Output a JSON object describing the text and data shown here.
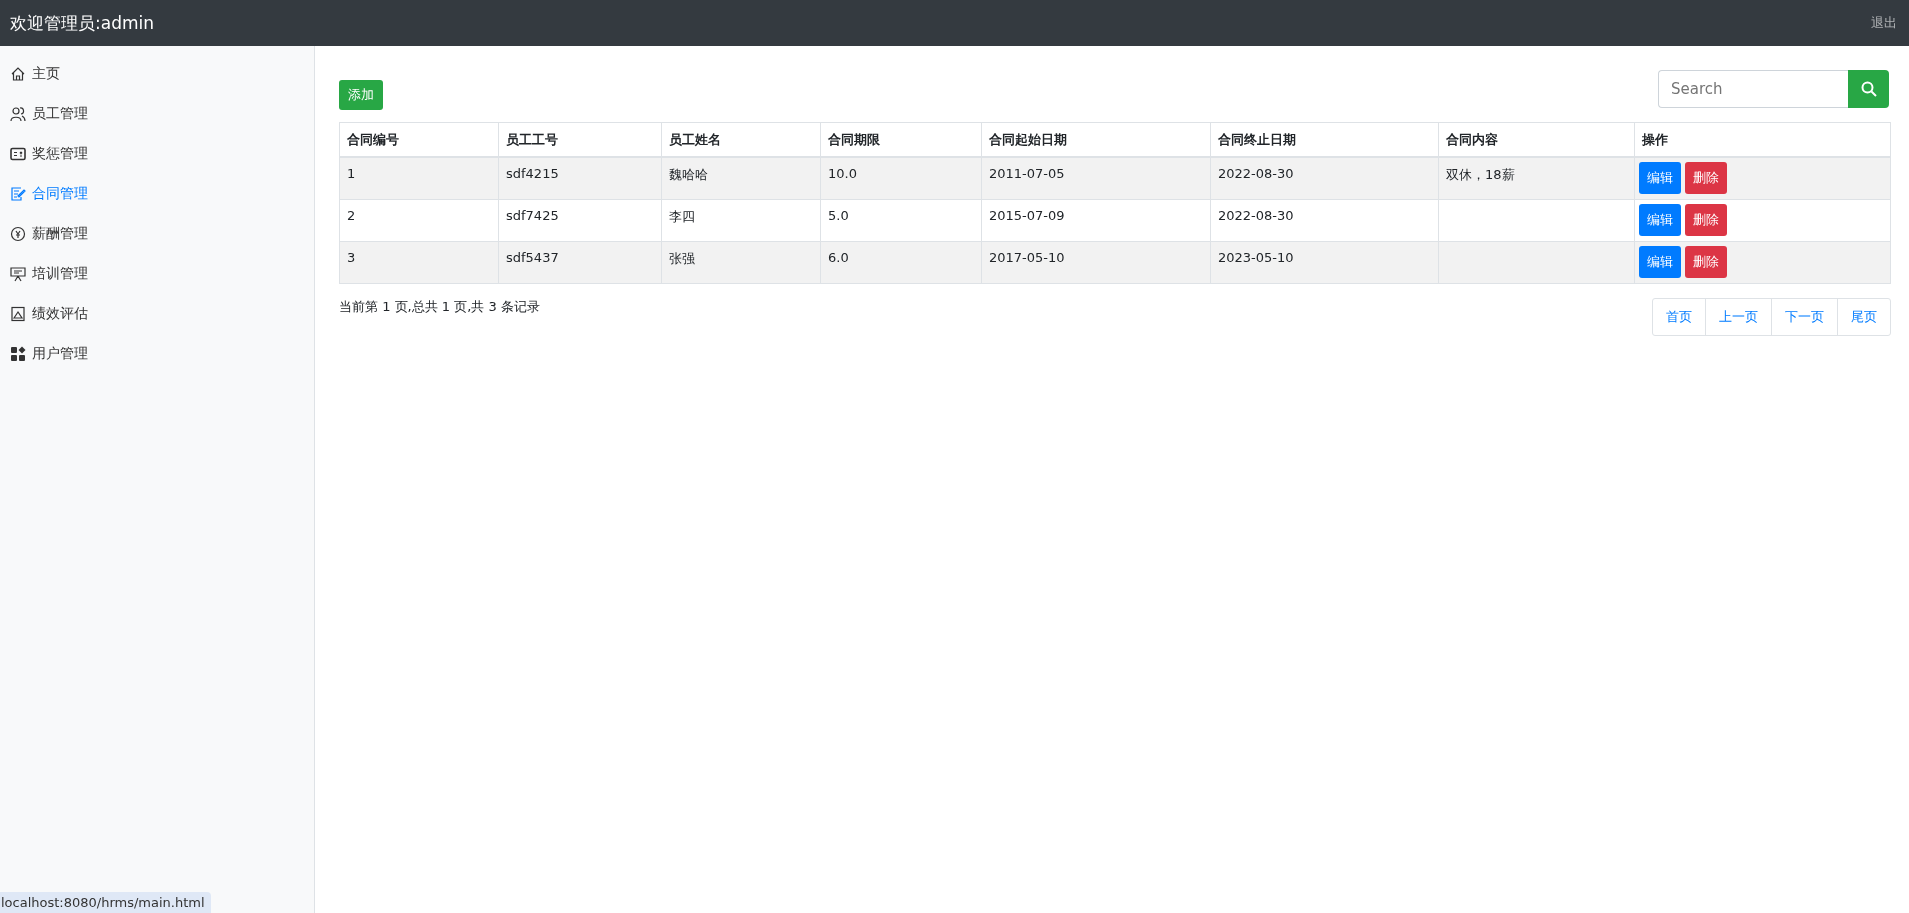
{
  "header": {
    "title": "欢迎管理员:admin",
    "logout": "退出"
  },
  "sidebar": {
    "items": [
      {
        "label": "主页",
        "selected": false
      },
      {
        "label": "员工管理",
        "selected": false
      },
      {
        "label": "奖惩管理",
        "selected": false
      },
      {
        "label": "合同管理",
        "selected": true
      },
      {
        "label": "薪酬管理",
        "selected": false
      },
      {
        "label": "培训管理",
        "selected": false
      },
      {
        "label": "绩效评估",
        "selected": false
      },
      {
        "label": "用户管理",
        "selected": false
      }
    ]
  },
  "toolbar": {
    "add_button": "添加",
    "search": {
      "placeholder": "Search"
    }
  },
  "table": {
    "columns": [
      "合同编号",
      "员工工号",
      "员工姓名",
      "合同期限",
      "合同起始日期",
      "合同终止日期",
      "合同内容",
      "操作"
    ],
    "rows": [
      {
        "cells": [
          "1",
          "sdf4215",
          "魏哈哈",
          "10.0",
          "2011-07-05",
          "2022-08-30",
          "双休，18薪"
        ],
        "actions": [
          "编辑",
          "删除"
        ]
      },
      {
        "cells": [
          "2",
          "sdf7425",
          "李四",
          "5.0",
          "2015-07-09",
          "2022-08-30",
          ""
        ],
        "actions": [
          "编辑",
          "删除"
        ]
      },
      {
        "cells": [
          "3",
          "sdf5437",
          "张强",
          "6.0",
          "2017-05-10",
          "2023-05-10",
          ""
        ],
        "actions": [
          "编辑",
          "删除"
        ]
      }
    ]
  },
  "pagination": {
    "summary": "当前第 1 页,总共 1 页,共 3 条记录",
    "links": [
      "首页",
      "上一页",
      "下一页",
      "尾页"
    ]
  },
  "status_bar": {
    "url": "localhost:8080/hrms/main.html"
  }
}
